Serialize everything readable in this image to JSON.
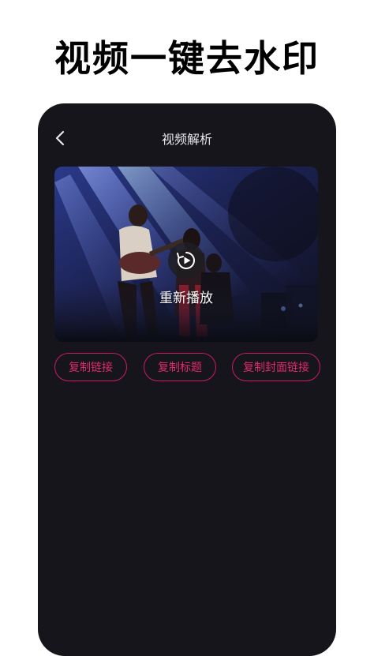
{
  "promo": {
    "title": "视频一键去水印"
  },
  "header": {
    "title": "视频解析",
    "back_icon": "chevron-left-icon"
  },
  "video": {
    "replay_icon": "replay-icon",
    "replay_label": "重新播放"
  },
  "actions": [
    {
      "label": "复制链接"
    },
    {
      "label": "复制标题"
    },
    {
      "label": "复制封面链接"
    }
  ],
  "colors": {
    "accent": "#e02a6c",
    "phone_bg": "#15151b",
    "page_bg": "#ffffff"
  }
}
